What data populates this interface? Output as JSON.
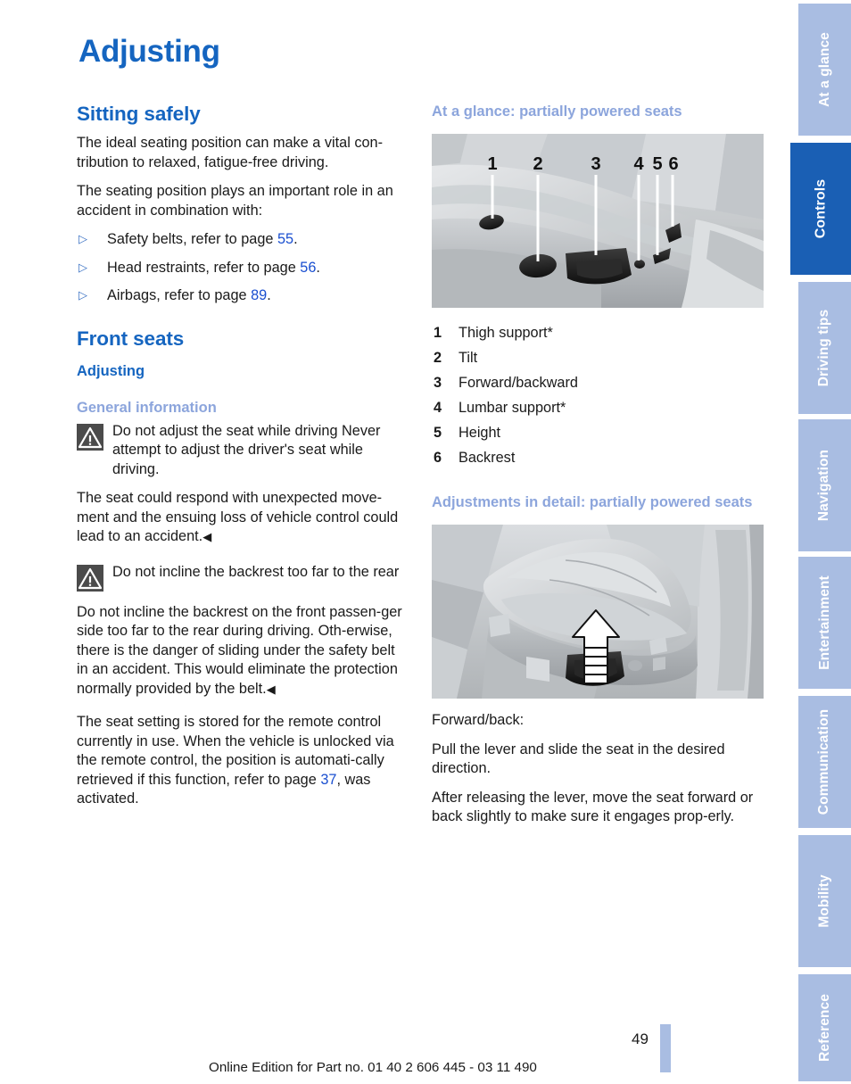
{
  "document": {
    "chapter_title": "Adjusting",
    "page_number": "49",
    "footer": "Online Edition for Part no. 01 40 2 606 445 - 03 11 490"
  },
  "colors": {
    "heading_blue": "#1565c0",
    "light_blue": "#8ca5dc",
    "tab_inactive": "#a9bde2",
    "tab_active": "#1a5fb4",
    "reference_link": "#1a4fd0",
    "warning_icon_bg": "#4b4b4b"
  },
  "sidebar": {
    "tabs": [
      {
        "label": "At a glance",
        "active": false
      },
      {
        "label": "Controls",
        "active": true
      },
      {
        "label": "Driving tips",
        "active": false
      },
      {
        "label": "Navigation",
        "active": false
      },
      {
        "label": "Entertainment",
        "active": false
      },
      {
        "label": "Communication",
        "active": false
      },
      {
        "label": "Mobility",
        "active": false
      },
      {
        "label": "Reference",
        "active": false
      }
    ]
  },
  "left_column": {
    "section_heading": "Sitting safely",
    "intro_p1": "The ideal seating position can make a vital con-tribution to relaxed, fatigue-free driving.",
    "intro_p2": "The seating position plays an important role in an accident in combination with:",
    "bullets": [
      {
        "text": "Safety belts, refer to page ",
        "page": "55",
        "tail": "."
      },
      {
        "text": "Head restraints, refer to page ",
        "page": "56",
        "tail": "."
      },
      {
        "text": "Airbags, refer to page ",
        "page": "89",
        "tail": "."
      }
    ],
    "front_seats_heading": "Front seats",
    "adjusting_subheading": "Adjusting",
    "general_info_heading": "General information",
    "warning1": {
      "title": "Do not adjust the seat while driving",
      "lead": "Never attempt to adjust the driver's seat while driving.",
      "body": "The seat could respond with unexpected move-ment and the ensuing loss of vehicle control could lead to an accident."
    },
    "warning2": {
      "title": "Do not incline the backrest too far to the rear",
      "body": "Do not incline the backrest on the front passen-ger side too far to the rear during driving. Oth-erwise, there is the danger of sliding under the safety belt in an accident. This would eliminate the protection normally provided by the belt."
    },
    "closing_p_a": "The seat setting is stored for the remote control currently in use. When the vehicle is unlocked via the remote control, the position is automati-cally retrieved if this function, refer to page ",
    "closing_page_ref": "37",
    "closing_p_b": ", was activated."
  },
  "right_column": {
    "at_a_glance_heading": "At a glance: partially powered seats",
    "figure1": {
      "name": "partially-powered-seat-controls-photo",
      "callouts": [
        "1",
        "2",
        "3",
        "4",
        "5",
        "6"
      ]
    },
    "legend": [
      {
        "num": "1",
        "label": "Thigh support*"
      },
      {
        "num": "2",
        "label": "Tilt"
      },
      {
        "num": "3",
        "label": "Forward/backward"
      },
      {
        "num": "4",
        "label": "Lumbar support*"
      },
      {
        "num": "5",
        "label": "Height"
      },
      {
        "num": "6",
        "label": "Backrest"
      }
    ],
    "details_heading": "Adjustments in detail: partially powered seats",
    "figure2": {
      "name": "seat-forward-back-lever-photo"
    },
    "forward_back_label": "Forward/back:",
    "forward_back_p1": "Pull the lever and slide the seat in the desired direction.",
    "forward_back_p2": "After releasing the lever, move the seat forward or back slightly to make sure it engages prop-erly."
  }
}
